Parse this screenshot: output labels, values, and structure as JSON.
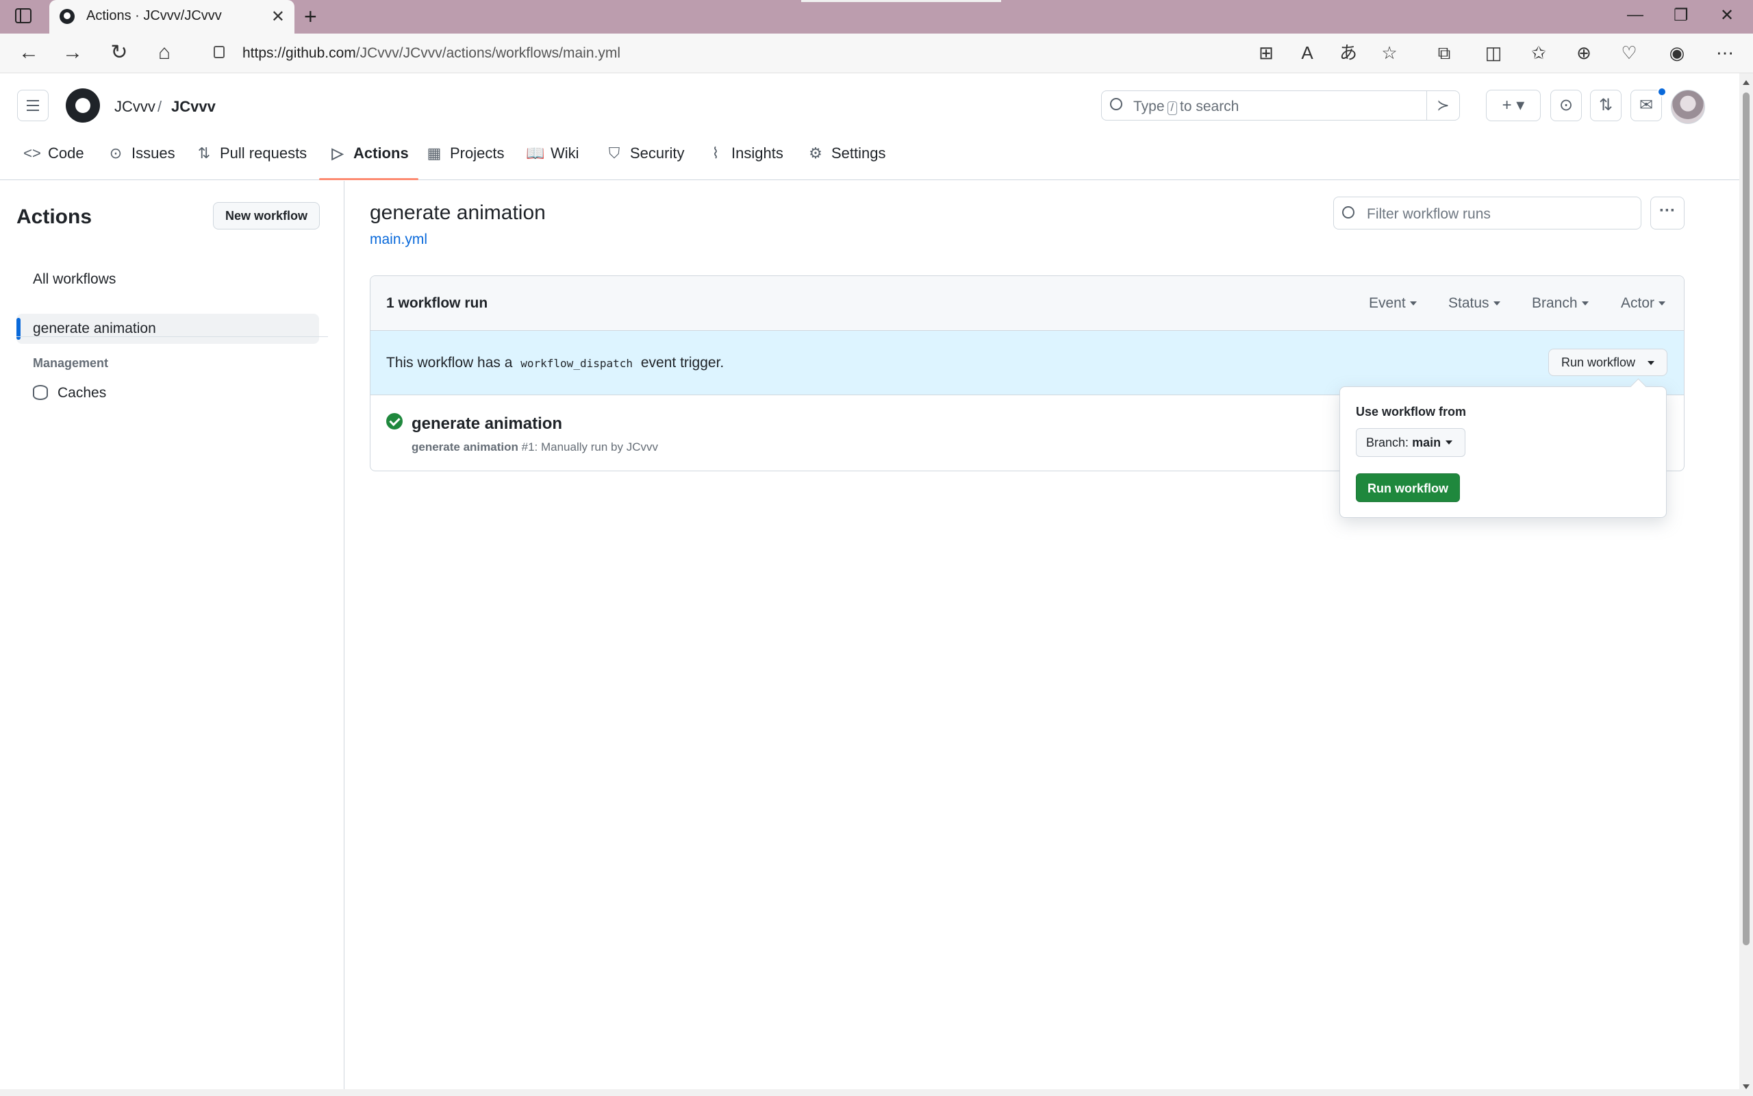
{
  "browser": {
    "tab_title": "Actions · JCvvv/JCvvv",
    "url_host": "https://github.com",
    "url_path": "/JCvvv/JCvvv/actions/workflows/main.yml"
  },
  "header": {
    "owner": "JCvvv",
    "separator": "/",
    "repo": "JCvvv",
    "search_prefix": "Type",
    "search_key": "/",
    "search_suffix": "to search"
  },
  "repo_tabs": [
    {
      "label": "Code",
      "icon": "code-icon"
    },
    {
      "label": "Issues",
      "icon": "issue-icon"
    },
    {
      "label": "Pull requests",
      "icon": "pull-request-icon"
    },
    {
      "label": "Actions",
      "icon": "play-icon"
    },
    {
      "label": "Projects",
      "icon": "table-icon"
    },
    {
      "label": "Wiki",
      "icon": "book-icon"
    },
    {
      "label": "Security",
      "icon": "shield-icon"
    },
    {
      "label": "Insights",
      "icon": "graph-icon"
    },
    {
      "label": "Settings",
      "icon": "gear-icon"
    }
  ],
  "sidebar": {
    "title": "Actions",
    "new_workflow": "New workflow",
    "items": [
      {
        "label": "All workflows"
      },
      {
        "label": "generate animation"
      }
    ],
    "management_heading": "Management",
    "caches": "Caches"
  },
  "main": {
    "workflow_title": "generate animation",
    "workflow_file": "main.yml",
    "filter_placeholder": "Filter workflow runs",
    "run_count": "1 workflow run",
    "filters": [
      "Event",
      "Status",
      "Branch",
      "Actor"
    ],
    "banner_prefix": "This workflow has a",
    "banner_code": "workflow_dispatch",
    "banner_suffix": "event trigger.",
    "run_workflow_button": "Run workflow",
    "run": {
      "title": "generate animation",
      "meta_name": "generate animation",
      "meta_rest": "#1: Manually run by JCvvv"
    }
  },
  "popover": {
    "label": "Use workflow from",
    "branch_prefix": "Branch:",
    "branch": "main",
    "run_button": "Run workflow"
  },
  "colors": {
    "accent": "#0969da",
    "success": "#1f883d",
    "tab_underline": "#fd8c73",
    "banner": "#ddf4ff",
    "browser_frame": "#bc9dae"
  }
}
